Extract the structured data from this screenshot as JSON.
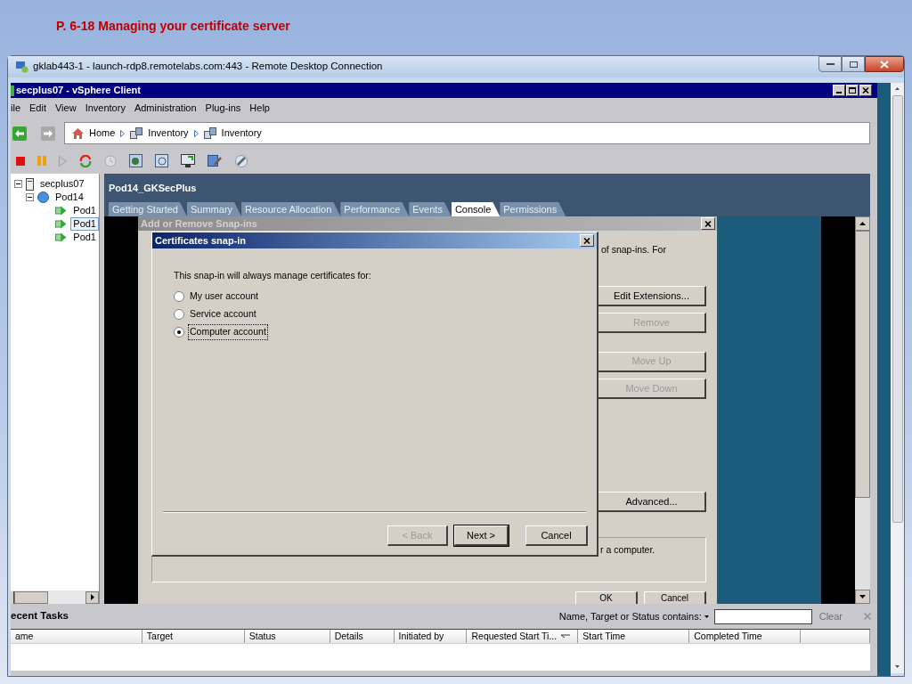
{
  "slide_title": "P. 6-18 Managing your certificate server",
  "rdp_window": {
    "title": "gklab443-1 - launch-rdp8.remotelabs.com:443 - Remote Desktop Connection"
  },
  "vsphere": {
    "title": "secplus07 - vSphere Client",
    "menu": [
      "ile",
      "Edit",
      "View",
      "Inventory",
      "Administration",
      "Plug-ins",
      "Help"
    ],
    "breadcrumb": [
      "Home",
      "Inventory",
      "Inventory"
    ],
    "tree": [
      {
        "label": "secplus07",
        "expanded": true,
        "children": [
          {
            "label": "Pod14",
            "expanded": true,
            "children": [
              {
                "label": "Pod1",
                "selected": false
              },
              {
                "label": "Pod1",
                "selected": true
              },
              {
                "label": "Pod1",
                "selected": false
              }
            ]
          }
        ]
      }
    ],
    "object_title": "Pod14_GKSecPlus",
    "tabs": [
      {
        "label": "Getting Started",
        "selected": false
      },
      {
        "label": "Summary",
        "selected": false
      },
      {
        "label": "Resource Allocation",
        "selected": false
      },
      {
        "label": "Performance",
        "selected": false
      },
      {
        "label": "Events",
        "selected": false
      },
      {
        "label": "Console",
        "selected": true
      },
      {
        "label": "Permissions",
        "selected": false
      }
    ]
  },
  "snapins_dialog": {
    "title": "Add or Remove Snap-ins",
    "text_fragment": "of snap-ins. For",
    "buttons": [
      {
        "label": "Edit Extensions...",
        "disabled": false
      },
      {
        "label": "Remove",
        "disabled": true
      },
      {
        "label": "Move Up",
        "disabled": true
      },
      {
        "label": "Move Down",
        "disabled": true
      },
      {
        "label": "Advanced...",
        "disabled": false
      }
    ],
    "description_fragment": "r a computer.",
    "footer_buttons": [
      "OK",
      "Cancel"
    ]
  },
  "certificates_dialog": {
    "title": "Certificates snap-in",
    "prompt": "This snap-in will always manage certificates for:",
    "options": [
      {
        "label": "My user account",
        "selected": false
      },
      {
        "label": "Service account",
        "selected": false
      },
      {
        "label": "Computer account",
        "selected": true
      }
    ],
    "buttons": [
      {
        "label": "< Back",
        "disabled": true,
        "default": false
      },
      {
        "label": "Next >",
        "disabled": false,
        "default": true
      },
      {
        "label": "Cancel",
        "disabled": false,
        "default": false
      }
    ]
  },
  "recent_tasks": {
    "title": "ecent Tasks",
    "filter_label": "Name, Target or Status contains:",
    "clear": {
      "label": "Clear",
      "disabled": true
    },
    "columns": [
      {
        "label": "ame",
        "sorted": false
      },
      {
        "label": "Target",
        "sorted": false
      },
      {
        "label": "Status",
        "sorted": false
      },
      {
        "label": "Details",
        "sorted": false
      },
      {
        "label": "Initiated by",
        "sorted": false
      },
      {
        "label": "Requested Start Ti...",
        "sorted": true
      },
      {
        "label": "Start Time",
        "sorted": false
      },
      {
        "label": "Completed Time",
        "sorted": false
      }
    ]
  }
}
